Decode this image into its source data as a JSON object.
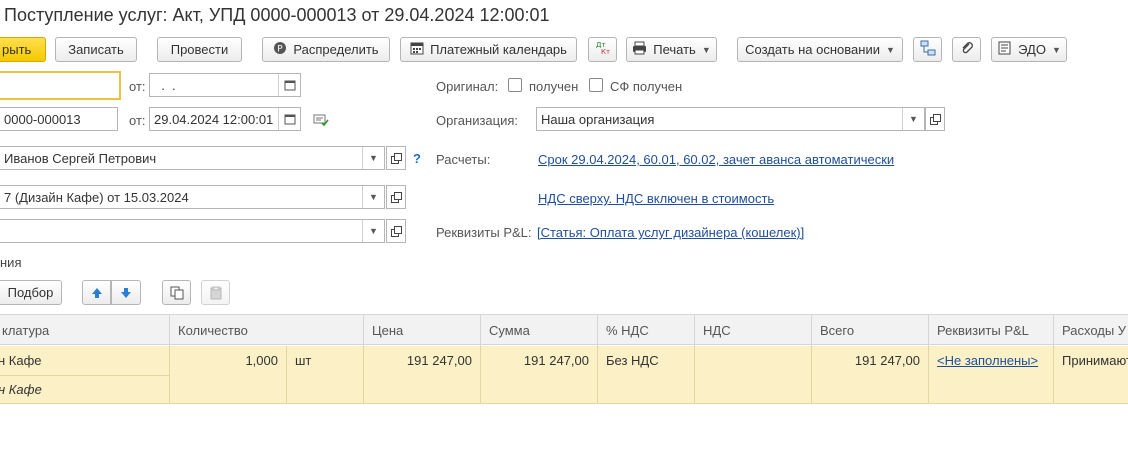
{
  "window": {
    "title": "Поступление услуг: Акт, УПД 0000-000013 от 29.04.2024 12:00:01"
  },
  "toolbar": {
    "post_close": "рыть",
    "save": "Записать",
    "post": "Провести",
    "distribute": "Распределить",
    "payment_calendar": "Платежный календарь",
    "dt_kt": "Дт\nКт",
    "print": "Печать",
    "create_based_on": "Создать на основании",
    "edo": "ЭДО"
  },
  "form": {
    "incoming_number": {
      "value": ""
    },
    "from_label_1": "от:",
    "incoming_date": {
      "value": "  .  ."
    },
    "number": {
      "value": "0000-000013"
    },
    "from_label_2": "от:",
    "date": {
      "value": "29.04.2024 12:00:01"
    },
    "counterparty": {
      "value": "Иванов Сергей Петрович"
    },
    "contract": {
      "value": "7 (Дизайн Кафе) от 15.03.2024"
    },
    "third": {
      "value": ""
    },
    "help": "?",
    "partial_label": "ния",
    "original_label": "Оригинал:",
    "original_received": "получен",
    "sf_received": "СФ получен",
    "organization_label": "Организация:",
    "organization": {
      "value": "Наша организация"
    },
    "settlements_label": "Расчеты:",
    "settlements_link": "Срок 29.04.2024, 60.01, 60.02, зачет аванса автоматически",
    "vat_link": "НДС сверху. НДС включен в стоимость",
    "pl_label": "Реквизиты P&L:",
    "pl_link": "[Статья: Оплата услуг дизайнера (кошелек)]"
  },
  "table_toolbar": {
    "pick": "Подбор"
  },
  "table": {
    "headers": [
      "клатура",
      "Количество",
      "Цена",
      "Сумма",
      "% НДС",
      "НДС",
      "Всего",
      "Реквизиты P&L",
      "Расходы У"
    ],
    "row": {
      "item": "н Кафе",
      "item_sub": "н Кафе",
      "qty": "1,000",
      "unit": "шт",
      "price": "191 247,00",
      "sum": "191 247,00",
      "vat_rate": "Без НДС",
      "vat": "",
      "total": "191 247,00",
      "pl": "<Не заполнены>",
      "expenses": "Принимают"
    }
  },
  "colors": {
    "accent_yellow": "#f5c800",
    "row_highlight": "#fbf0c6",
    "link": "#1f4e9c"
  }
}
